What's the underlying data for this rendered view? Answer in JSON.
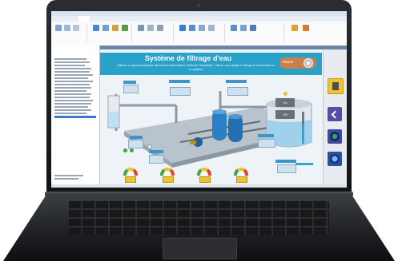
{
  "app": {
    "banner_title": "Système de filtrage d'eau",
    "banner_subtitle": "Affichez un grand synoptique affichant les informations reliées de l'installation. Cliquez pour ajuster le filtrage et commencer sur ce système.",
    "retour_label": "Retour",
    "on_label": "On",
    "off_label": "Off"
  },
  "colors": {
    "banner": "#2aa1c9",
    "retour_button": "#c8814d",
    "accent_blue": "#3a97c7",
    "tank_blue": "#2c7fc4",
    "pipe_gray": "#8e99a5"
  },
  "icons": {
    "retour": "retour-dial-icon",
    "nav_1": "device-icon",
    "nav_2": "chevron-left-icon",
    "nav_3": "gauge-icon",
    "nav_4": "dial-icon"
  }
}
